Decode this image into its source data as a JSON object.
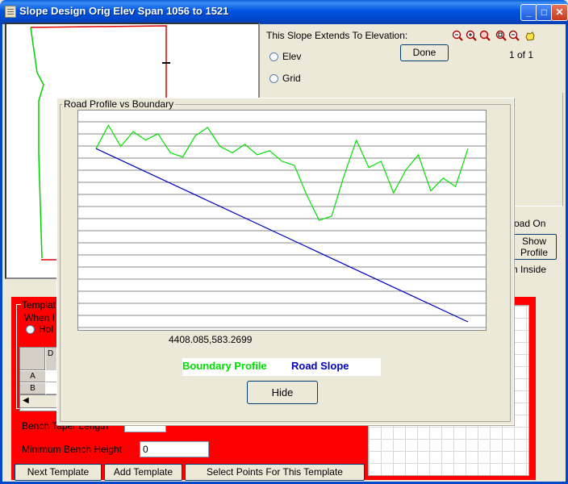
{
  "window": {
    "title": "Slope Design Orig Elev Span 1056 to 1521",
    "minimize_icon": "minimize-icon",
    "maximize_icon": "maximize-icon",
    "close_icon": "close-icon"
  },
  "controls": {
    "extends_label": "This Slope Extends To Elevation:",
    "radio_elev": "Elev",
    "radio_grid": "Grid",
    "done_label": "Done",
    "page_indicator": "1 of 1",
    "zoom_icons": [
      "zoom-out-icon",
      "zoom-in-icon",
      "zoom-window-icon",
      "zoom-extents-icon",
      "zoom-previous-icon",
      "pan-hand-icon"
    ],
    "road_on_label": "oad On",
    "show_profile_line1": "Show",
    "show_profile_line2": "Profile",
    "inside_label": "n Inside"
  },
  "template_panel": {
    "legend": "Templat",
    "when_label": "When I",
    "hold_label": "Hol",
    "grid_header": "D",
    "grid_rows": [
      "A",
      "B"
    ],
    "bench_taper_label": "Bench Taper Length",
    "min_bench_label": "Minimum Bench Height",
    "min_bench_value": "0",
    "buttons": {
      "next_template": "Next Template",
      "add_template": "Add Template",
      "select_points": "Select Points For This Template"
    }
  },
  "profile_dialog": {
    "title": "Road Profile vs Boundary",
    "coord_readout": "4408.085,583.2699",
    "legend_boundary": "Boundary Profile",
    "legend_road": "Road Slope",
    "hide_label": "Hide",
    "colors": {
      "boundary": "#00e000",
      "road": "#0000c0"
    }
  },
  "chart_data": {
    "type": "line",
    "title": "Road Profile vs Boundary",
    "xlabel": "",
    "ylabel": "",
    "grid": true,
    "series": [
      {
        "name": "Boundary Profile",
        "color": "#00e000",
        "values": [
          0.82,
          0.93,
          0.83,
          0.9,
          0.86,
          0.89,
          0.8,
          0.78,
          0.88,
          0.92,
          0.83,
          0.8,
          0.84,
          0.79,
          0.81,
          0.76,
          0.74,
          0.6,
          0.48,
          0.5,
          0.69,
          0.86,
          0.73,
          0.76,
          0.61,
          0.72,
          0.79,
          0.62,
          0.68,
          0.64,
          0.82
        ]
      },
      {
        "name": "Road Slope",
        "color": "#0000c0",
        "values": [
          0.82,
          0.0
        ]
      }
    ]
  }
}
